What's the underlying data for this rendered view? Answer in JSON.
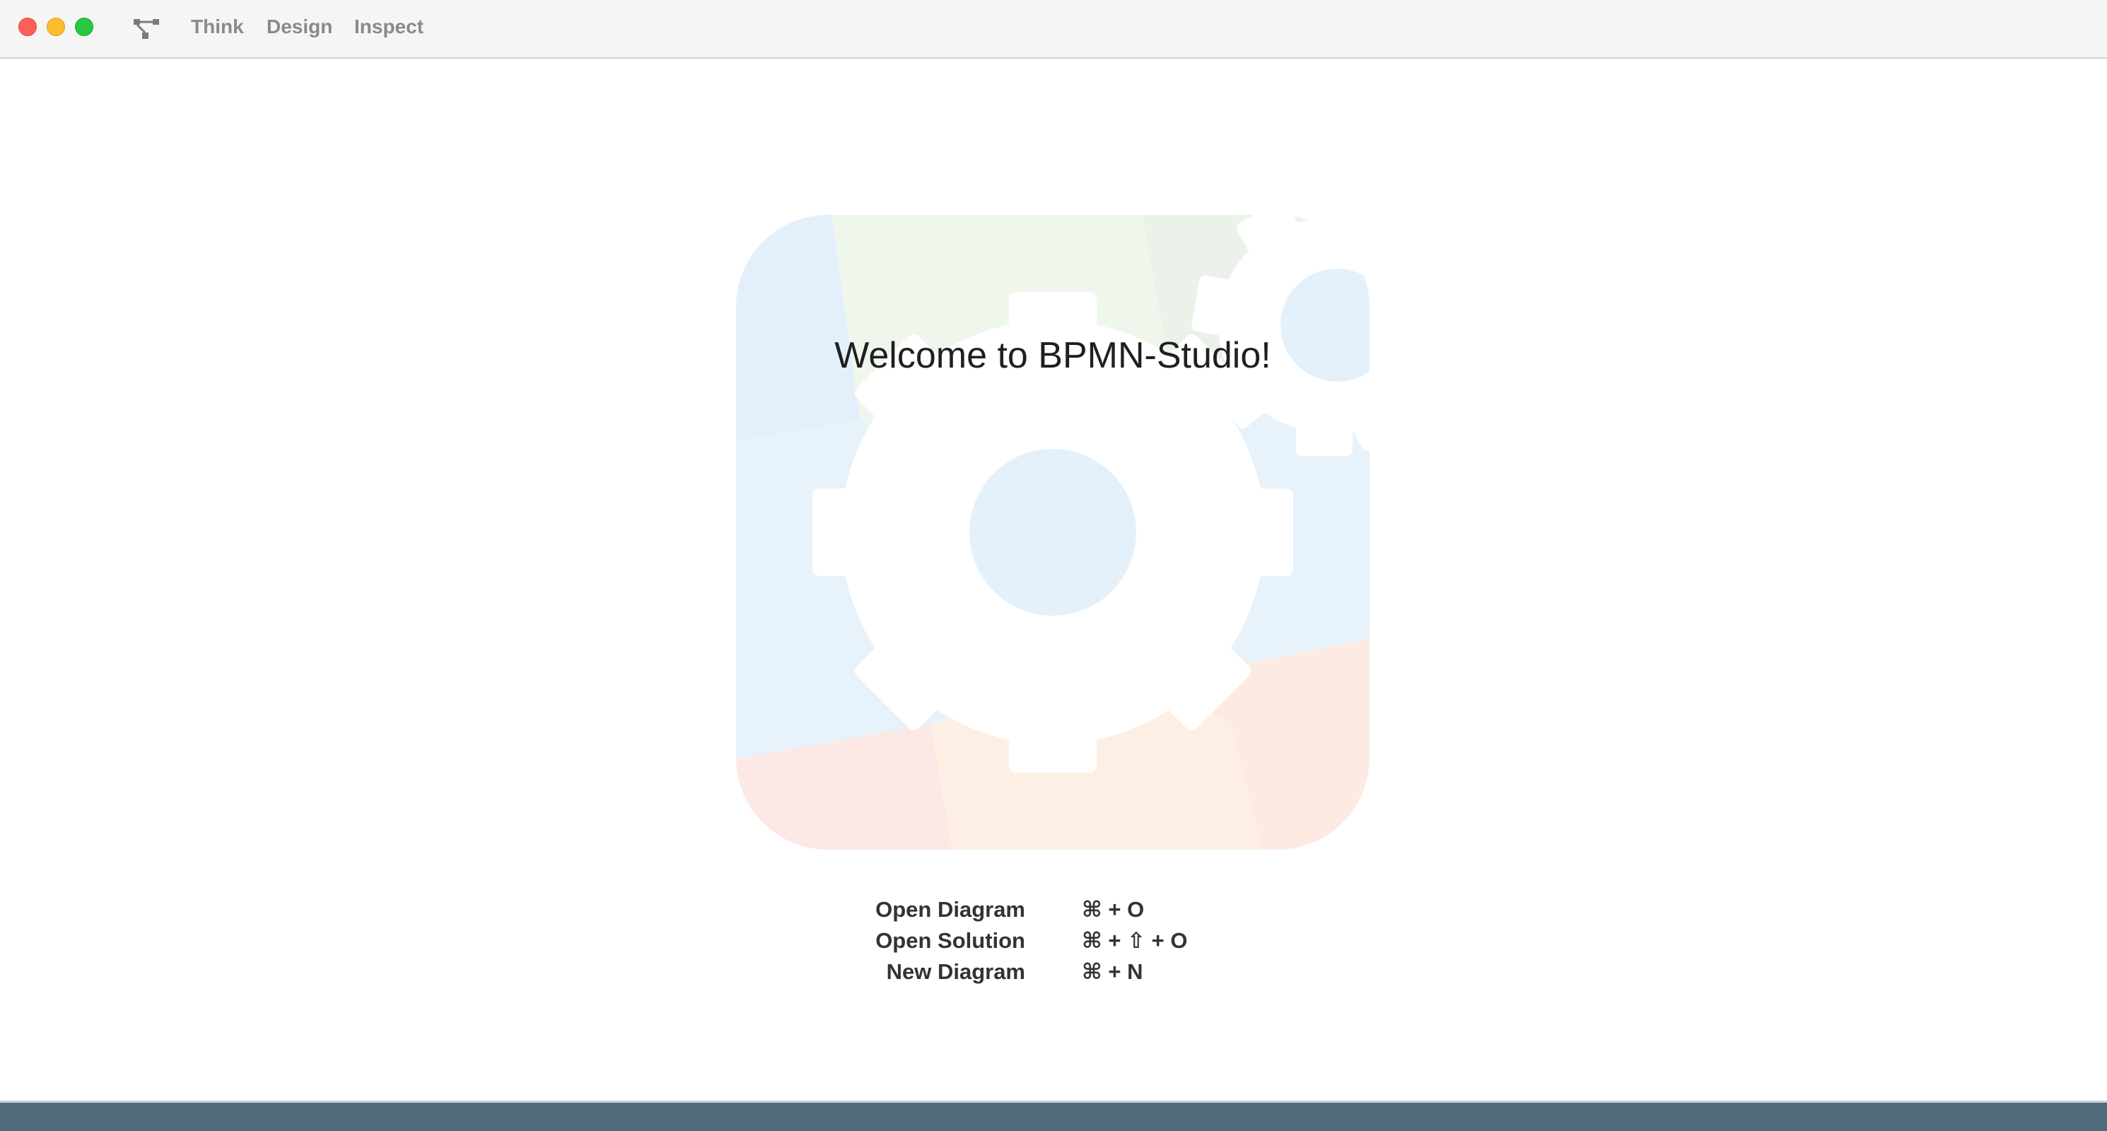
{
  "window": {
    "traffic_lights": [
      "close-button",
      "minimize-button",
      "maximize-button"
    ]
  },
  "toolbar": {
    "app_icon": "process-diagram-icon",
    "nav_items": [
      {
        "label": "Think"
      },
      {
        "label": "Design"
      },
      {
        "label": "Inspect"
      }
    ]
  },
  "welcome": {
    "title": "Welcome to BPMN-Studio!",
    "logo_icon": "gear-logo-icon",
    "shortcuts": [
      {
        "label": "Open Diagram",
        "keys": "⌘ + O"
      },
      {
        "label": "Open Solution",
        "keys": "⌘ + ⇧ + O"
      },
      {
        "label": "New Diagram",
        "keys": "⌘ + N"
      }
    ]
  },
  "colors": {
    "titlebar_bg": "#f5f5f5",
    "nav_text": "#8a8a8a",
    "statusbar_bg": "#506b7b",
    "close": "#fe5f57",
    "minimize": "#febc2e",
    "maximize": "#28c840"
  }
}
